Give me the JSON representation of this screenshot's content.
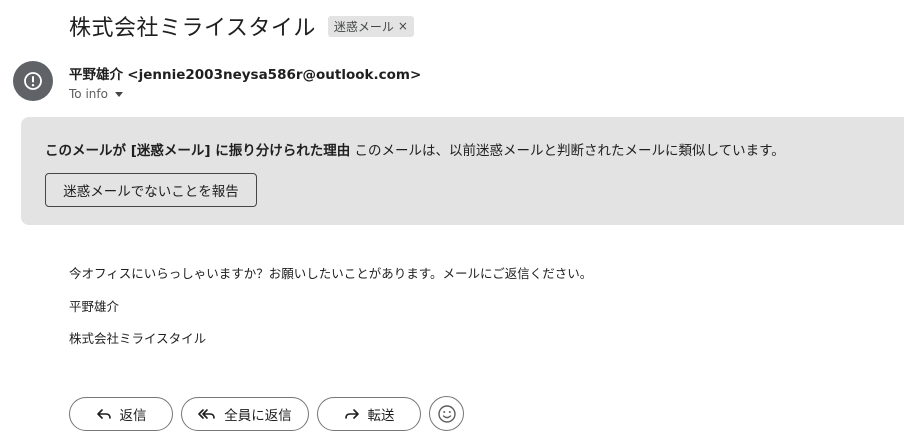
{
  "subject": {
    "title": "株式会社ミライスタイル",
    "label": "迷惑メール",
    "label_remove": "×"
  },
  "sender": {
    "avatar_icon": "alert-circle-icon",
    "name": "平野雄介",
    "email": "<jennie2003neysa586r@outlook.com>",
    "to_text": "To info"
  },
  "spam_banner": {
    "reason_bold": "このメールが [迷惑メール] に振り分けられた理由",
    "reason_text": "このメールは、以前迷惑メールと判断されたメールに類似しています。",
    "report_button": "迷惑メールでないことを報告"
  },
  "body": {
    "line1": "今オフィスにいらっしゃいますか？お願いしたいことがあります。メールにご返信ください。",
    "line2": "平野雄介",
    "line3": "株式会社ミライスタイル"
  },
  "actions": {
    "reply": "返信",
    "reply_all": "全員に返信",
    "forward": "転送",
    "emoji_icon": "emoji-smile-icon"
  },
  "colors": {
    "banner_bg": "#e3e3e3",
    "avatar_bg": "#5f6368",
    "text": "#1f1f1f"
  }
}
